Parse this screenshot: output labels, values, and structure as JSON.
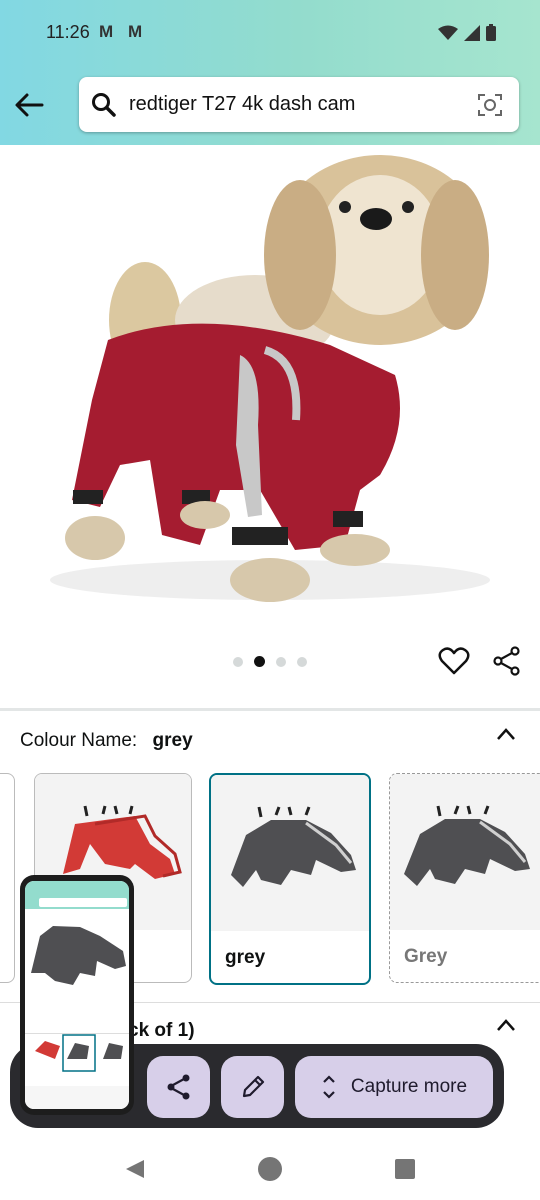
{
  "status": {
    "time": "11:26",
    "mail_icon": "M"
  },
  "search": {
    "query": "redtiger T27 4k dash cam"
  },
  "carousel": {
    "dots": 4,
    "active": 1
  },
  "colour": {
    "label": "Colour Name:",
    "value": "grey"
  },
  "swatches": [
    {
      "label": ""
    },
    {
      "label": "grey"
    },
    {
      "label": "Grey"
    }
  ],
  "pack": {
    "label_partial": "ck of 1)"
  },
  "capture": {
    "more_label": "Capture more"
  },
  "colors": {
    "accent": "#007185",
    "capture_btn": "#d7cfe9",
    "toolbar": "#2a2a2e",
    "jacket": "#a51c30"
  }
}
